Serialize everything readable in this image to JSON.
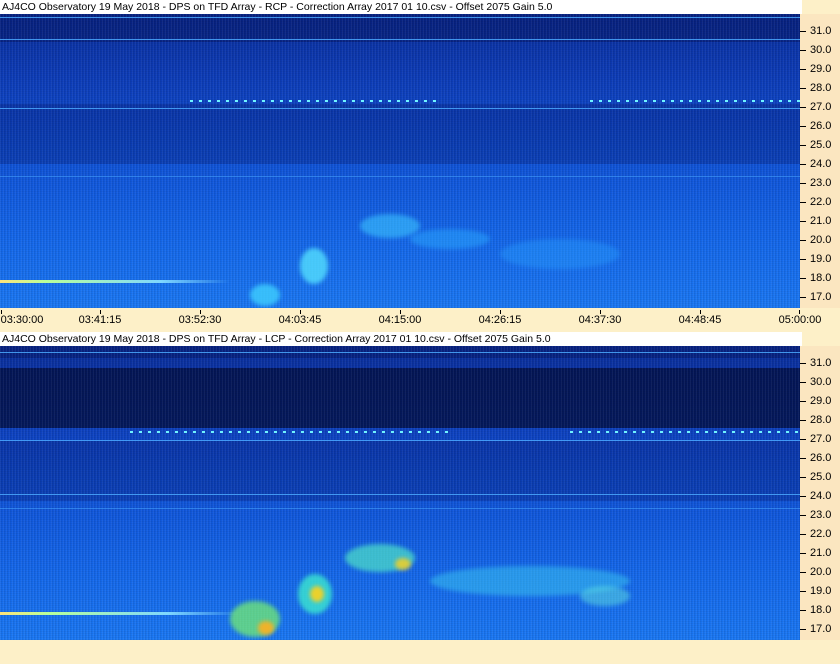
{
  "panels": [
    {
      "title": "AJ4CO Observatory 19 May 2018   -  DPS on TFD Array   -  RCP   -  Correction Array 2017 01 10.csv   -  Offset 2075  Gain 5.0",
      "freq_labels": [
        "31.0",
        "30.0",
        "29.0",
        "28.0",
        "27.0",
        "26.0",
        "25.0",
        "24.0",
        "23.0",
        "22.0",
        "21.0",
        "20.0",
        "19.0",
        "18.0",
        "17.0"
      ]
    },
    {
      "title": "AJ4CO Observatory 19 May 2018   -  DPS on TFD Array   -  LCP   -  Correction Array 2017 01 10.csv   -  Offset 2075  Gain 5.0",
      "freq_labels": [
        "31.0",
        "30.0",
        "29.0",
        "28.0",
        "27.0",
        "26.0",
        "25.0",
        "24.0",
        "23.0",
        "22.0",
        "21.0",
        "20.0",
        "19.0",
        "18.0",
        "17.0"
      ]
    }
  ],
  "time_labels": [
    "03:30:00",
    "03:41:15",
    "03:52:30",
    "04:03:45",
    "04:15:00",
    "04:26:15",
    "04:37:30",
    "04:48:45",
    "05:00:00"
  ],
  "colors": {
    "background": "#fdf0c8",
    "spectrogram_low": "#0a2e9a",
    "spectrogram_high": "#1a78f4",
    "emission_hot": "#ffd21a"
  }
}
